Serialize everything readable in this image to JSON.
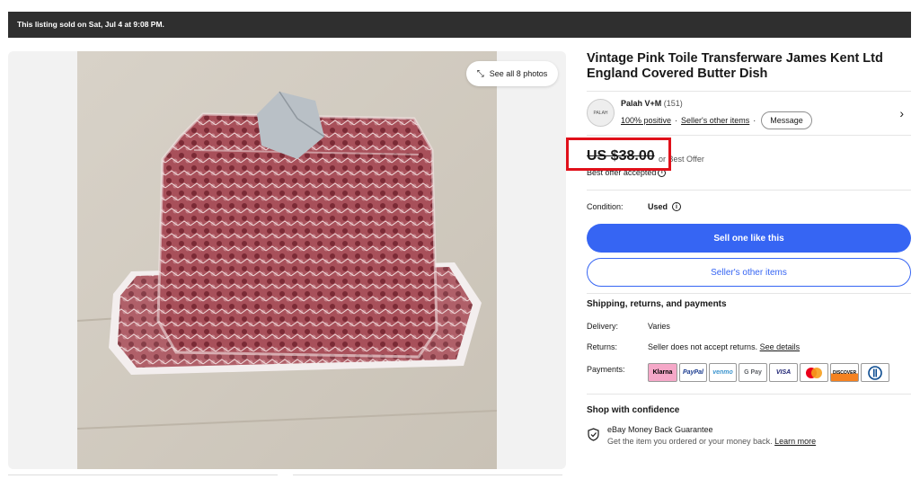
{
  "banner": {
    "text": "This listing sold on Sat, Jul 4 at 9:08 PM."
  },
  "gallery": {
    "see_all": "See all 8 photos",
    "expand_icon": "expand-arrows-icon"
  },
  "listing": {
    "title": "Vintage Pink Toile Transferware James Kent Ltd England Covered Butter Dish"
  },
  "seller": {
    "name": "Palah V+M",
    "feedback_count": "(151)",
    "positive": "100% positive",
    "separator": "·",
    "other_items": "Seller's other items",
    "message_button": "Message",
    "logo_text": "PALAH"
  },
  "price": {
    "amount": "US $38.00",
    "or_best_offer": "or Best Offer",
    "best_offer_accepted": "Best offer accepted"
  },
  "condition": {
    "label": "Condition:",
    "value": "Used"
  },
  "buttons": {
    "sell_one": "Sell one like this",
    "sellers_other_items": "Seller's other items"
  },
  "shipping": {
    "heading": "Shipping, returns, and payments",
    "delivery_label": "Delivery:",
    "delivery_value": "Varies",
    "returns_label": "Returns:",
    "returns_value": "Seller does not accept returns.",
    "returns_link": "See details",
    "payments_label": "Payments:",
    "payment_methods": [
      "Klarna",
      "PayPal",
      "venmo",
      "G Pay",
      "VISA",
      "Mastercard",
      "DISCOVER",
      "Diners Club"
    ]
  },
  "confidence": {
    "heading": "Shop with confidence",
    "guarantee_title": "eBay Money Back Guarantee",
    "guarantee_sub": "Get the item you ordered or your money back.",
    "learn_more": "Learn more"
  },
  "colors": {
    "primary": "#3665f3",
    "banner": "#2f2f2f",
    "highlight": "#e0101a"
  }
}
